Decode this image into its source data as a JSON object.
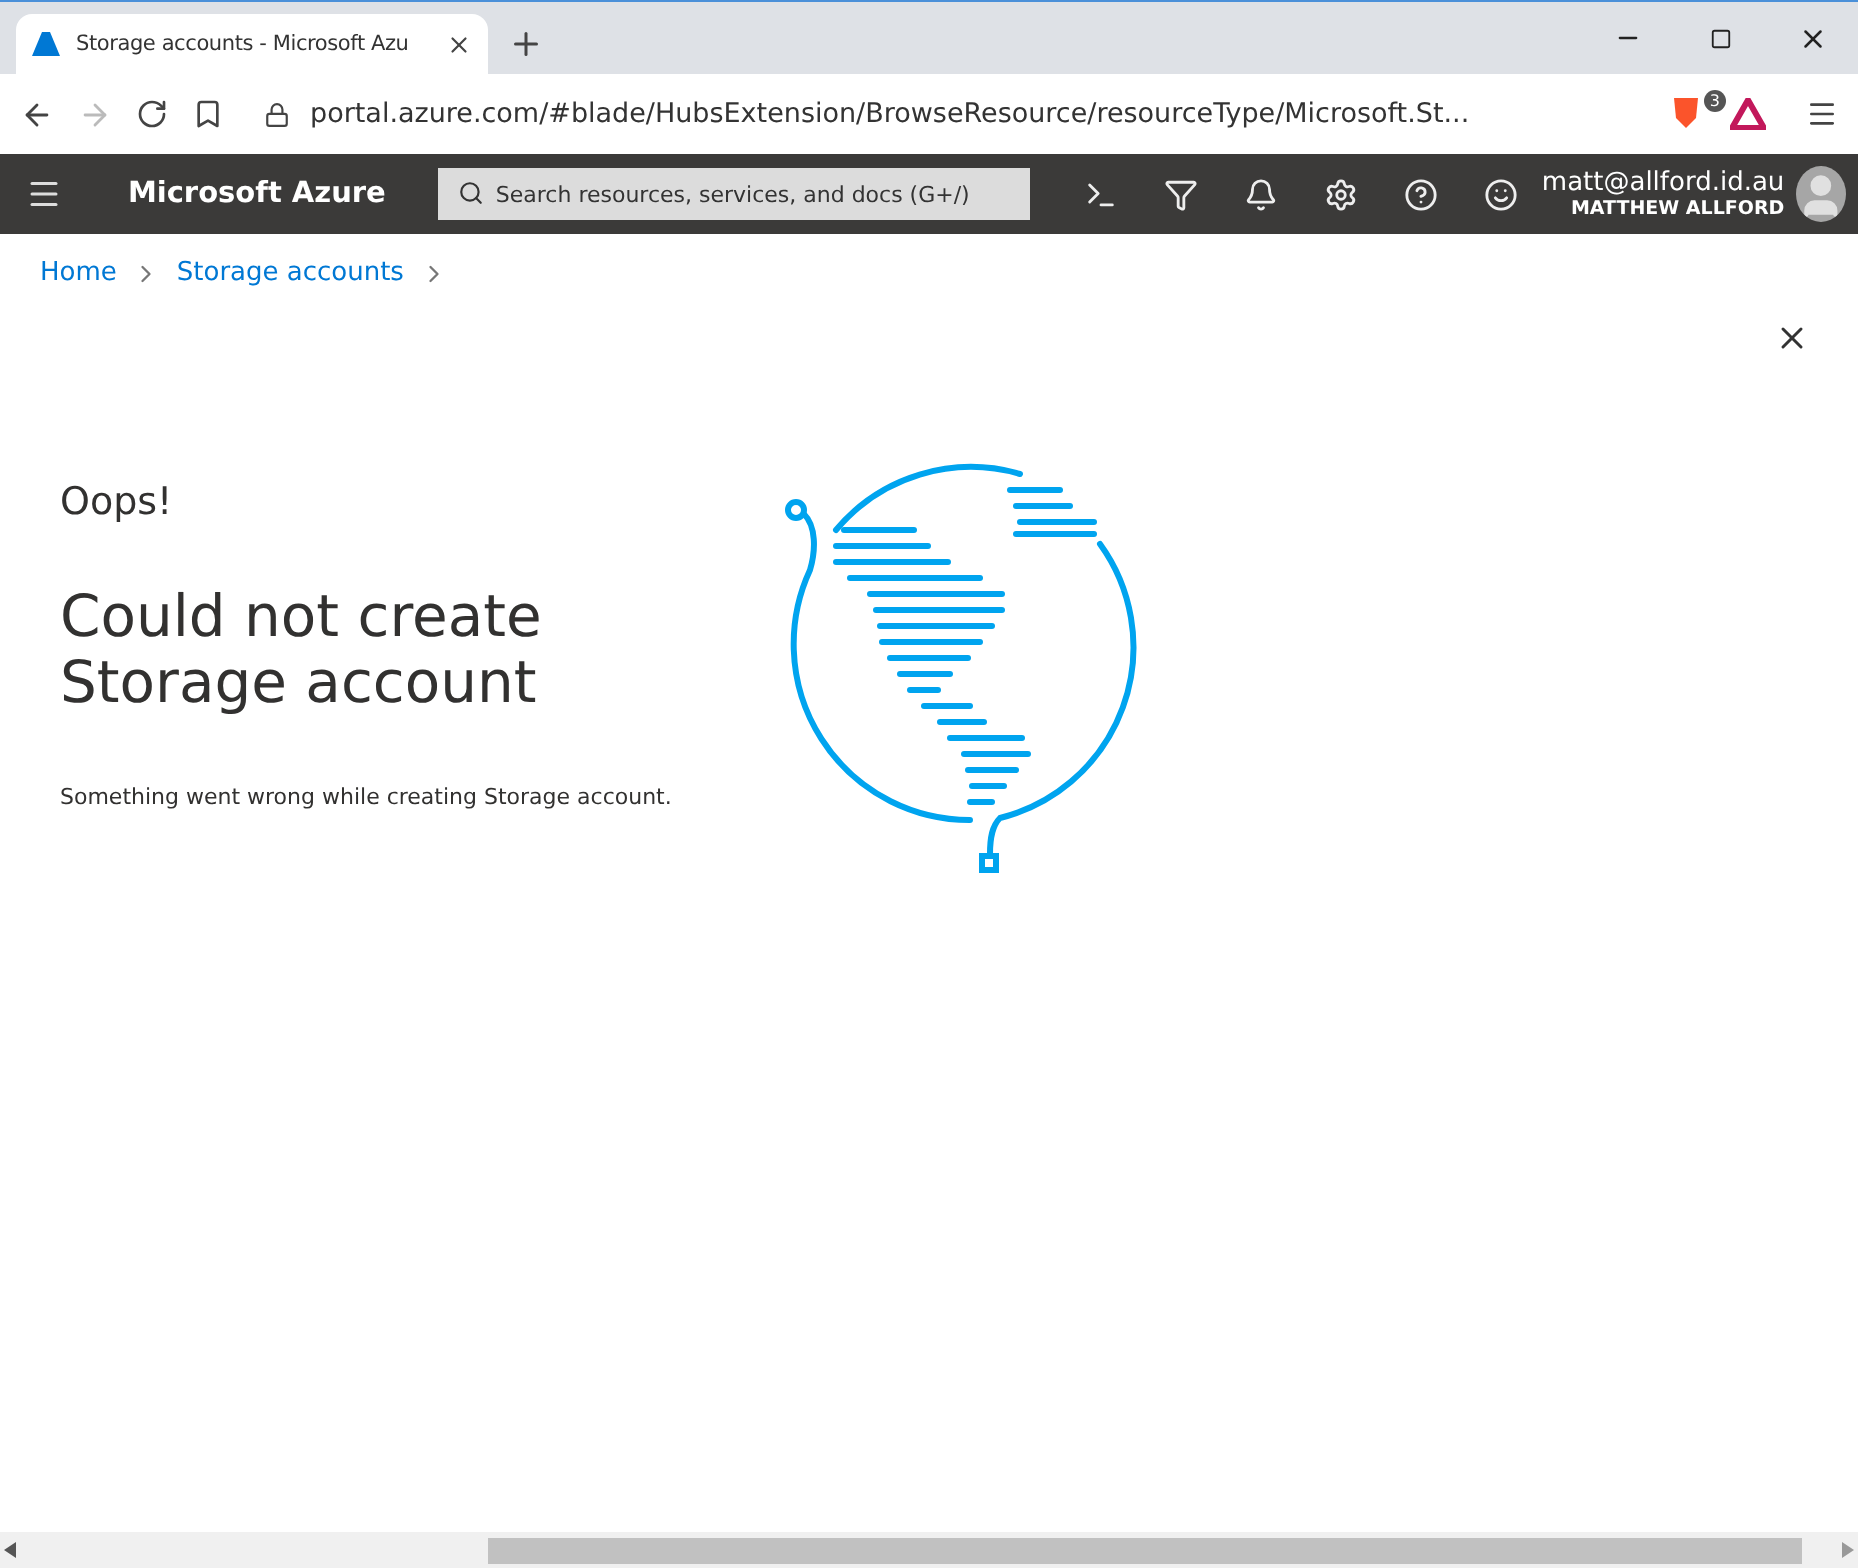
{
  "browser": {
    "tabs": [
      {
        "title": "Storage accounts - Microsoft Azu",
        "selected": true
      }
    ],
    "url": "portal.azure.com/#blade/HubsExtension/BrowseResource/resourceType/Microsoft.St...",
    "extension_badge": "3"
  },
  "header": {
    "brand": "Microsoft Azure",
    "search": {
      "placeholder": "Search resources, services, and docs (G+/)"
    },
    "user": {
      "email": "matt@allford.id.au",
      "name": "MATTHEW ALLFORD"
    }
  },
  "breadcrumb": [
    "Home",
    "Storage accounts"
  ],
  "error": {
    "kicker": "Oops!",
    "title": "Could not create Storage account",
    "message": "Something went wrong while creating Storage account."
  }
}
